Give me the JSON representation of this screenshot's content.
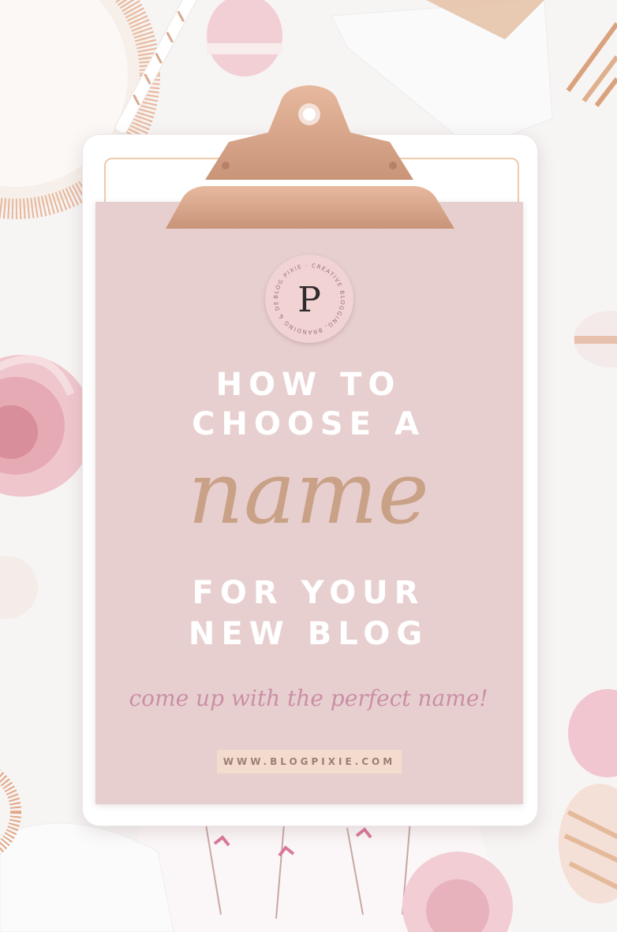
{
  "pin": {
    "logo_letter": "P",
    "logo_ring_text": "BLOG PIXIE · CREATIVE BLOGGING, BRANDING & DESIGN ·",
    "headline_line1": "HOW TO",
    "headline_line2": "CHOOSE A",
    "script_word": "name",
    "headline_line3": "FOR YOUR",
    "headline_line4": "NEW BLOG",
    "tagline": "come up with the perfect name!",
    "url": "WWW.BLOGPIXIE.COM"
  },
  "colors": {
    "background": "#f7f4f4",
    "paper": "#e8cfcf",
    "rose_gold": "#d9a98f",
    "script_tan": "#c9a187",
    "tagline_mauve": "#c98fa6",
    "url_box": "#f3dccd",
    "white_text": "#ffffff"
  }
}
